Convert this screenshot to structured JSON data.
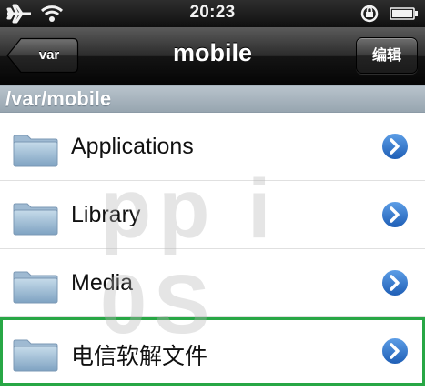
{
  "status_bar": {
    "time": "20:23",
    "icons": [
      "airplane-icon",
      "wifi-icon",
      "rotation-lock-icon",
      "battery-icon"
    ]
  },
  "navbar": {
    "title": "mobile",
    "back_label": "var",
    "edit_label": "编辑"
  },
  "path": "/var/mobile",
  "items": [
    {
      "label": "Applications",
      "icon": "folder-icon"
    },
    {
      "label": "Library",
      "icon": "folder-icon"
    },
    {
      "label": "Media",
      "icon": "folder-icon"
    },
    {
      "label": "电信软解文件",
      "icon": "folder-icon"
    }
  ],
  "watermark": "pp i 0S",
  "colors": {
    "accent_disclosure": "#2f74c8",
    "highlight_border": "#28a745",
    "path_header": "#a9b5bf"
  }
}
